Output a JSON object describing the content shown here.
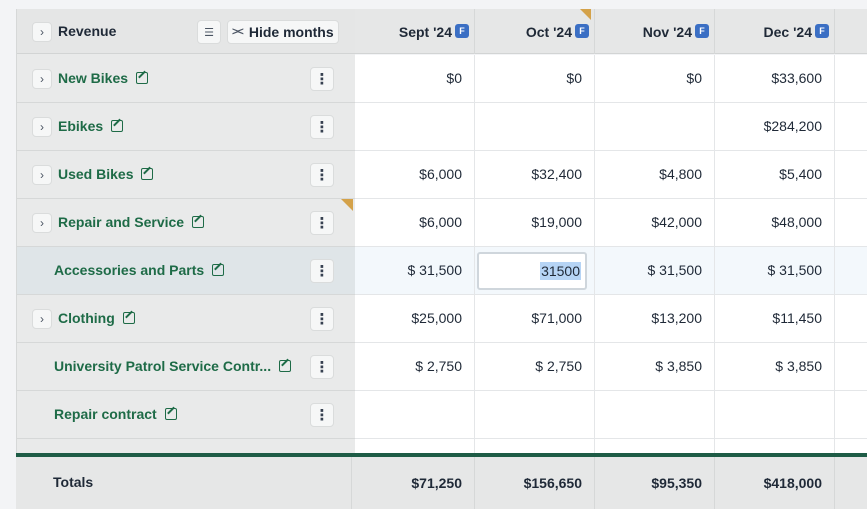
{
  "header": {
    "title": "Revenue",
    "hide_months_label": "Hide months",
    "forecast_badge": "F",
    "months": [
      "Sept '24",
      "Oct '24",
      "Nov '24",
      "Dec '24"
    ]
  },
  "rows": [
    {
      "label": "New Bikes",
      "expandable": true,
      "values": [
        "$0",
        "$0",
        "$0",
        "$33,600"
      ]
    },
    {
      "label": "Ebikes",
      "expandable": true,
      "values": [
        "",
        "",
        "",
        "$284,200"
      ]
    },
    {
      "label": "Used Bikes",
      "expandable": true,
      "values": [
        "$6,000",
        "$32,400",
        "$4,800",
        "$5,400"
      ]
    },
    {
      "label": "Repair and Service",
      "expandable": true,
      "values": [
        "$6,000",
        "$19,000",
        "$42,000",
        "$48,000"
      ]
    },
    {
      "label": "Accessories and Parts",
      "expandable": false,
      "values": [
        "$ 31,500",
        "",
        "$ 31,500",
        "$ 31,500"
      ],
      "editing_value": "31500"
    },
    {
      "label": "Clothing",
      "expandable": true,
      "values": [
        "$25,000",
        "$71,000",
        "$13,200",
        "$11,450"
      ]
    },
    {
      "label": "University Patrol Service Contr...",
      "expandable": false,
      "values": [
        "$ 2,750",
        "$ 2,750",
        "$ 3,850",
        "$ 3,850"
      ]
    },
    {
      "label": "Repair contract",
      "expandable": false,
      "values": [
        "",
        "",
        "",
        ""
      ]
    }
  ],
  "totals": {
    "label": "Totals",
    "values": [
      "$71,250",
      "$156,650",
      "$95,350",
      "$418,000"
    ]
  },
  "colors": {
    "label_green": "#1e6b47",
    "badge_blue": "#3b6fc4",
    "divider_green": "#1e5c46",
    "flag_orange": "#d4a24a",
    "selection_blue": "#b6d4f5"
  }
}
